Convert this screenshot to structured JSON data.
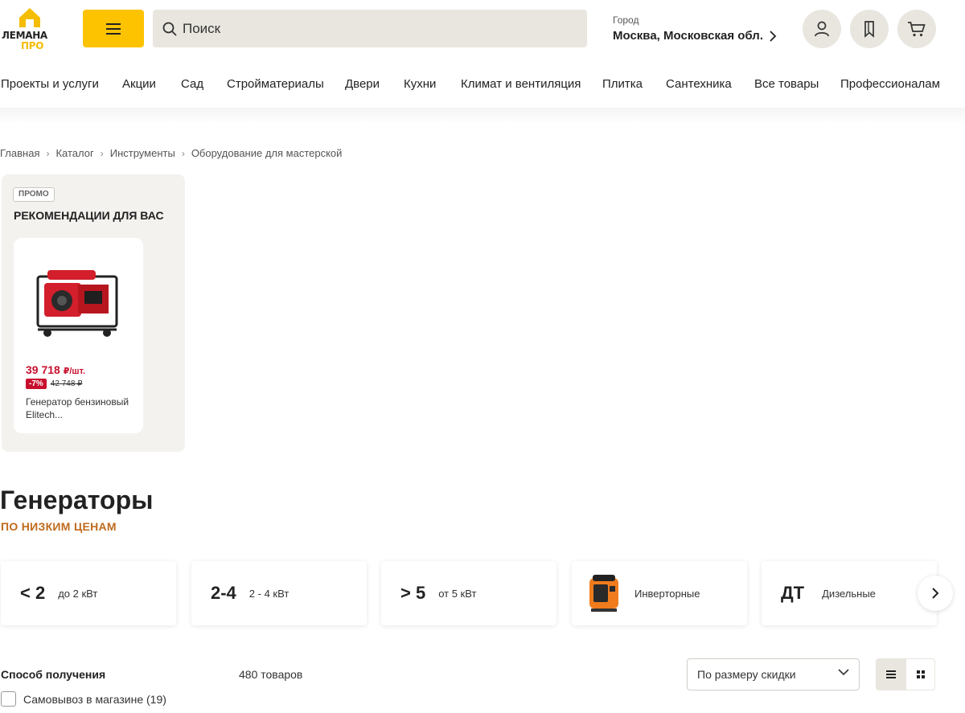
{
  "header": {
    "logo_line1": "ЛЕМАНА",
    "logo_line2": "ПРО",
    "search_placeholder": "Поиск",
    "city_label": "Город",
    "city_value": "Москва, Московская обл."
  },
  "nav": {
    "items": [
      "Проекты и услуги",
      "Акции",
      "Сад",
      "Стройматериалы",
      "Двери",
      "Кухни",
      "Климат и вентиляция",
      "Плитка",
      "Сантехника",
      "Все товары",
      "Профессионалам"
    ]
  },
  "breadcrumb": [
    "Главная",
    "Каталог",
    "Инструменты",
    "Оборудование для мастерской"
  ],
  "promo": {
    "badge": "ПРОМО",
    "title": "РЕКОМЕНДАЦИИ ДЛЯ ВАС",
    "product": {
      "price": "39 718",
      "price_unit": "₽/шт.",
      "discount": "-7%",
      "old_price": "42 748 ₽",
      "name": "Генератор бензиновый Elitech..."
    }
  },
  "page": {
    "title": "Генераторы",
    "subtitle": "ПО НИЗКИМ ЦЕНАМ"
  },
  "tiles": [
    {
      "big": "< 2",
      "small": "до 2 кВт"
    },
    {
      "big": "2-4",
      "small": "2 - 4 кВт"
    },
    {
      "big": "> 5",
      "small": "от 5 кВт"
    },
    {
      "big": "",
      "small": "Инверторные"
    },
    {
      "big": "ДТ",
      "small": "Дизельные"
    }
  ],
  "filters": {
    "title": "Способ получения",
    "pickup_label": "Самовывоз в магазине (19)"
  },
  "results": {
    "count": "480 товаров",
    "sort_label": "По размеру скидки"
  },
  "colors": {
    "accent_yellow": "#fdc300",
    "price_red": "#c8102e",
    "subtitle_orange": "#c06a1c",
    "surface_beige": "#e8e6df"
  }
}
